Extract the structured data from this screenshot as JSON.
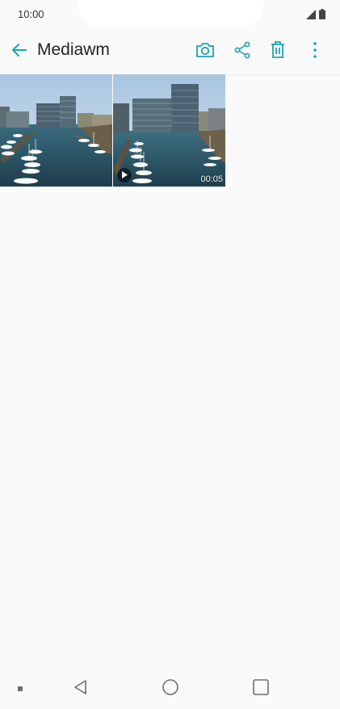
{
  "status_bar": {
    "time": "10:00",
    "icons": [
      "signal-icon",
      "battery-icon"
    ]
  },
  "app_bar": {
    "title": "Mediawm",
    "icons": [
      "back-arrow-icon",
      "camera-icon",
      "share-icon",
      "trash-icon",
      "more-vert-icon"
    ]
  },
  "colors": {
    "accent": "#1aa3b0",
    "background": "#fafafa",
    "text": "#222222"
  },
  "media": [
    {
      "type": "photo"
    },
    {
      "type": "video",
      "duration": "00:05"
    }
  ],
  "nav_bar": {
    "icons": [
      "back-triangle-icon",
      "home-circle-icon",
      "recents-square-icon"
    ]
  }
}
